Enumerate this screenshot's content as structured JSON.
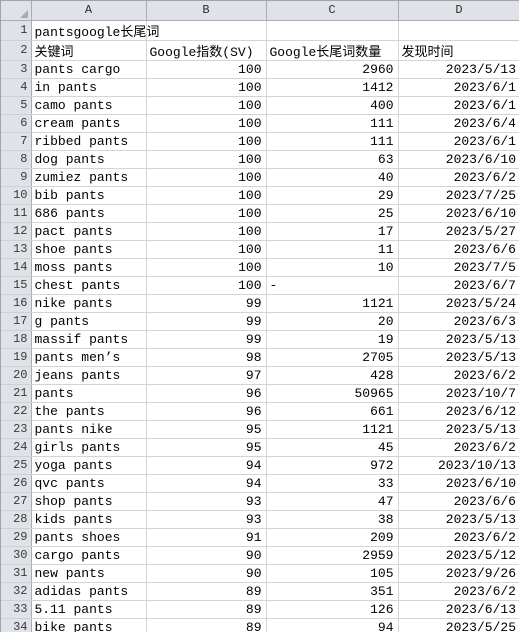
{
  "app": {
    "type": "spreadsheet",
    "select_all_icon": "select-all-triangle-icon"
  },
  "columns": [
    {
      "id": "A",
      "label": "A"
    },
    {
      "id": "B",
      "label": "B"
    },
    {
      "id": "C",
      "label": "C"
    },
    {
      "id": "D",
      "label": "D"
    }
  ],
  "title_row": {
    "row_number": "1",
    "value": "pantsgoogle长尾词"
  },
  "header_row": {
    "row_number": "2",
    "cells": [
      "关键词",
      "Google指数(SV)",
      "Google长尾词数量",
      "发现时间"
    ]
  },
  "rows": [
    {
      "n": "3",
      "keyword": "pants cargo",
      "index": "100",
      "longtail": "2960",
      "date": "2023/5/13"
    },
    {
      "n": "4",
      "keyword": "in pants",
      "index": "100",
      "longtail": "1412",
      "date": "2023/6/1"
    },
    {
      "n": "5",
      "keyword": "camo pants",
      "index": "100",
      "longtail": "400",
      "date": "2023/6/1"
    },
    {
      "n": "6",
      "keyword": "cream pants",
      "index": "100",
      "longtail": "111",
      "date": "2023/6/4"
    },
    {
      "n": "7",
      "keyword": "ribbed pants",
      "index": "100",
      "longtail": "111",
      "date": "2023/6/1"
    },
    {
      "n": "8",
      "keyword": "dog pants",
      "index": "100",
      "longtail": "63",
      "date": "2023/6/10"
    },
    {
      "n": "9",
      "keyword": "zumiez pants",
      "index": "100",
      "longtail": "40",
      "date": "2023/6/2"
    },
    {
      "n": "10",
      "keyword": "bib pants",
      "index": "100",
      "longtail": "29",
      "date": "2023/7/25"
    },
    {
      "n": "11",
      "keyword": "686 pants",
      "index": "100",
      "longtail": "25",
      "date": "2023/6/10"
    },
    {
      "n": "12",
      "keyword": "pact pants",
      "index": "100",
      "longtail": "17",
      "date": "2023/5/27"
    },
    {
      "n": "13",
      "keyword": "shoe pants",
      "index": "100",
      "longtail": "11",
      "date": "2023/6/6"
    },
    {
      "n": "14",
      "keyword": "moss pants",
      "index": "100",
      "longtail": "10",
      "date": "2023/7/5"
    },
    {
      "n": "15",
      "keyword": "chest pants",
      "index": "100",
      "longtail": "-",
      "date": "2023/6/7",
      "longtail_align": "left"
    },
    {
      "n": "16",
      "keyword": "nike pants",
      "index": "99",
      "longtail": "1121",
      "date": "2023/5/24"
    },
    {
      "n": "17",
      "keyword": "g pants",
      "index": "99",
      "longtail": "20",
      "date": "2023/6/3"
    },
    {
      "n": "18",
      "keyword": "massif pants",
      "index": "99",
      "longtail": "19",
      "date": "2023/5/13"
    },
    {
      "n": "19",
      "keyword": "pants men’s",
      "index": "98",
      "longtail": "2705",
      "date": "2023/5/13"
    },
    {
      "n": "20",
      "keyword": "jeans pants",
      "index": "97",
      "longtail": "428",
      "date": "2023/6/2"
    },
    {
      "n": "21",
      "keyword": "pants",
      "index": "96",
      "longtail": "50965",
      "date": "2023/10/7"
    },
    {
      "n": "22",
      "keyword": "the pants",
      "index": "96",
      "longtail": "661",
      "date": "2023/6/12"
    },
    {
      "n": "23",
      "keyword": "pants nike",
      "index": "95",
      "longtail": "1121",
      "date": "2023/5/13"
    },
    {
      "n": "24",
      "keyword": "girls pants",
      "index": "95",
      "longtail": "45",
      "date": "2023/6/2"
    },
    {
      "n": "25",
      "keyword": "yoga pants",
      "index": "94",
      "longtail": "972",
      "date": "2023/10/13"
    },
    {
      "n": "26",
      "keyword": "qvc pants",
      "index": "94",
      "longtail": "33",
      "date": "2023/6/10"
    },
    {
      "n": "27",
      "keyword": "shop pants",
      "index": "93",
      "longtail": "47",
      "date": "2023/6/6"
    },
    {
      "n": "28",
      "keyword": "kids pants",
      "index": "93",
      "longtail": "38",
      "date": "2023/5/13"
    },
    {
      "n": "29",
      "keyword": "pants shoes",
      "index": "91",
      "longtail": "209",
      "date": "2023/6/2"
    },
    {
      "n": "30",
      "keyword": "cargo pants",
      "index": "90",
      "longtail": "2959",
      "date": "2023/5/12"
    },
    {
      "n": "31",
      "keyword": "new pants",
      "index": "90",
      "longtail": "105",
      "date": "2023/9/26"
    },
    {
      "n": "32",
      "keyword": "adidas pants",
      "index": "89",
      "longtail": "351",
      "date": "2023/6/2"
    },
    {
      "n": "33",
      "keyword": "5.11 pants",
      "index": "89",
      "longtail": "126",
      "date": "2023/6/13"
    },
    {
      "n": "34",
      "keyword": "bike pants",
      "index": "89",
      "longtail": "94",
      "date": "2023/5/25"
    }
  ],
  "colors": {
    "header_bg": "#dfe2e7",
    "gridline": "#d4d4d4",
    "header_border": "#a8adb4",
    "text": "#000000"
  }
}
